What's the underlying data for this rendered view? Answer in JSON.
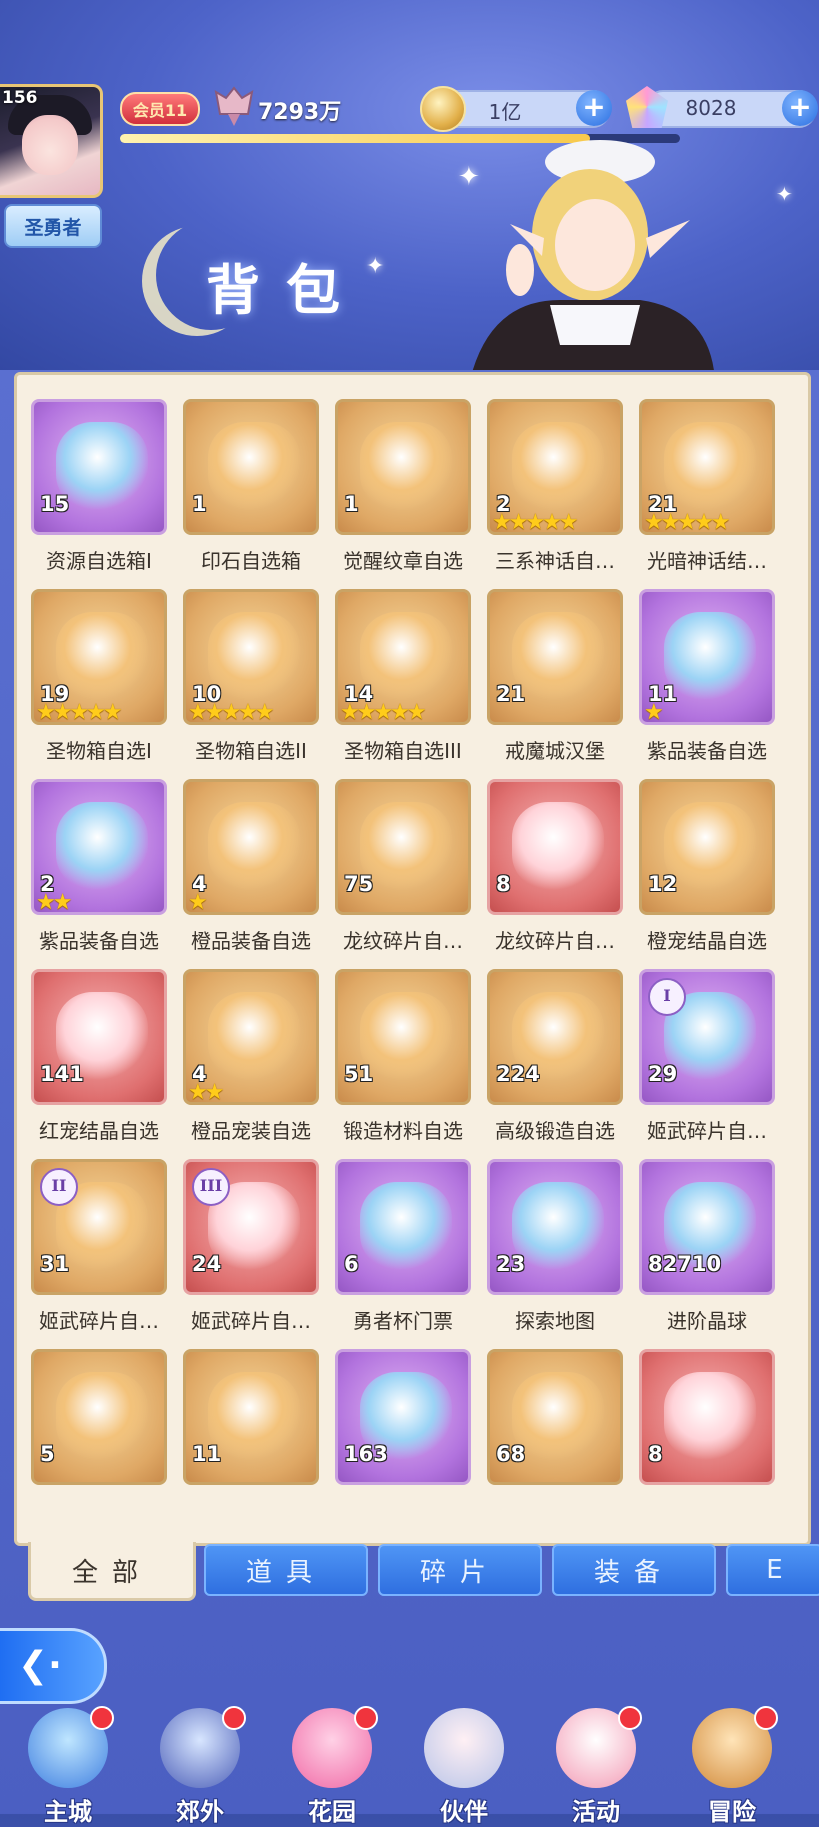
{
  "header": {
    "level": "156",
    "player_title": "圣勇者",
    "vip_label": "会员11",
    "power": "7293万",
    "coins": "1亿",
    "gems": "8028",
    "exp_fraction": 0.84,
    "page_title": "背包"
  },
  "colors": {
    "accent_blue": "#2f6fe0",
    "panel_bg": "#f7efe1",
    "star_gold": "#ffcc1a",
    "badge_red": "#f0343d"
  },
  "items": [
    {
      "name": "资源自选箱I",
      "count": "15",
      "rarity": "purple",
      "icon": "blue-pouch-icon",
      "stars": 0
    },
    {
      "name": "印石自选箱",
      "count": "1",
      "rarity": "orange",
      "icon": "gem-chest-icon",
      "stars": 0
    },
    {
      "name": "觉醒纹章自选",
      "count": "1",
      "rarity": "orange",
      "icon": "emblem-chest-icon",
      "stars": 0
    },
    {
      "name": "三系神话自…",
      "count": "2",
      "rarity": "orange",
      "icon": "mythic-card-icon",
      "stars": 5
    },
    {
      "name": "光暗神话结…",
      "count": "21",
      "rarity": "orange",
      "icon": "gift-box-icon",
      "stars": 5
    },
    {
      "name": "圣物箱自选I",
      "count": "19",
      "rarity": "orange",
      "icon": "relic-box-green-icon",
      "stars": 5
    },
    {
      "name": "圣物箱自选II",
      "count": "10",
      "rarity": "orange",
      "icon": "relic-box-blue-icon",
      "stars": 5
    },
    {
      "name": "圣物箱自选III",
      "count": "14",
      "rarity": "orange",
      "icon": "relic-box-gold-icon",
      "stars": 5
    },
    {
      "name": "戒魔城汉堡",
      "count": "21",
      "rarity": "orange",
      "icon": "burger-icon",
      "stars": 0
    },
    {
      "name": "紫品装备自选",
      "count": "11",
      "rarity": "purple",
      "icon": "purple-equip-box-icon",
      "stars": 1
    },
    {
      "name": "紫品装备自选",
      "count": "2",
      "rarity": "purple",
      "icon": "purple-equip-box-icon",
      "stars": 2
    },
    {
      "name": "橙品装备自选",
      "count": "4",
      "rarity": "orange",
      "icon": "orange-equip-box-icon",
      "stars": 1
    },
    {
      "name": "龙纹碎片自…",
      "count": "75",
      "rarity": "orange",
      "icon": "dragon-fragment-icon",
      "stars": 0
    },
    {
      "name": "龙纹碎片自…",
      "count": "8",
      "rarity": "red",
      "icon": "dragon-fragment-red-icon",
      "stars": 0
    },
    {
      "name": "橙宠结晶自选",
      "count": "12",
      "rarity": "orange",
      "icon": "orange-egg-icon",
      "stars": 0
    },
    {
      "name": "红宠结晶自选",
      "count": "141",
      "rarity": "red",
      "icon": "red-egg-icon",
      "stars": 0
    },
    {
      "name": "橙品宠装自选",
      "count": "4",
      "rarity": "orange",
      "icon": "pet-gear-box-icon",
      "stars": 2
    },
    {
      "name": "锻造材料自选",
      "count": "51",
      "rarity": "orange",
      "icon": "forge-chest-red-icon",
      "stars": 0
    },
    {
      "name": "高级锻造自选",
      "count": "224",
      "rarity": "orange",
      "icon": "forge-chest-gold-icon",
      "stars": 0
    },
    {
      "name": "姬武碎片自…",
      "count": "29",
      "rarity": "purple",
      "icon": "heart-box-purple-icon",
      "stars": 0,
      "badge": "I"
    },
    {
      "name": "姬武碎片自…",
      "count": "31",
      "rarity": "orange",
      "icon": "heart-box-orange-icon",
      "stars": 0,
      "badge": "II"
    },
    {
      "name": "姬武碎片自…",
      "count": "24",
      "rarity": "red",
      "icon": "heart-box-red-icon",
      "stars": 0,
      "badge": "III"
    },
    {
      "name": "勇者杯门票",
      "count": "6",
      "rarity": "purple",
      "icon": "ticket-icon",
      "stars": 0
    },
    {
      "name": "探索地图",
      "count": "23",
      "rarity": "purple",
      "icon": "scroll-map-icon",
      "stars": 0
    },
    {
      "name": "进阶晶球",
      "count": "82710",
      "rarity": "purple",
      "icon": "crystal-orb-icon",
      "stars": 0
    },
    {
      "name": "",
      "count": "5",
      "rarity": "orange",
      "icon": "gold-coin-icon",
      "stars": 0
    },
    {
      "name": "",
      "count": "11",
      "rarity": "orange",
      "icon": "flower-ticket-icon",
      "stars": 0
    },
    {
      "name": "",
      "count": "163",
      "rarity": "purple",
      "icon": "hand-icon",
      "stars": 0
    },
    {
      "name": "",
      "count": "68",
      "rarity": "orange",
      "icon": "whip-icon",
      "stars": 0
    },
    {
      "name": "",
      "count": "8",
      "rarity": "red",
      "icon": "lips-icon",
      "stars": 0
    }
  ],
  "tabs": [
    {
      "label": "全部",
      "active": true
    },
    {
      "label": "道具",
      "active": false
    },
    {
      "label": "碎片",
      "active": false
    },
    {
      "label": "装备",
      "active": false
    },
    {
      "label": "E",
      "active": false
    }
  ],
  "bottom_nav": [
    {
      "label": "主城",
      "icon": "castle-icon",
      "dot": true
    },
    {
      "label": "郊外",
      "icon": "star-seal-icon",
      "dot": true
    },
    {
      "label": "花园",
      "icon": "heart-garden-icon",
      "dot": true
    },
    {
      "label": "伙伴",
      "icon": "partner-icon",
      "dot": false
    },
    {
      "label": "活动",
      "icon": "gift-icon",
      "dot": true
    },
    {
      "label": "冒险",
      "icon": "sword-icon",
      "dot": true
    }
  ]
}
